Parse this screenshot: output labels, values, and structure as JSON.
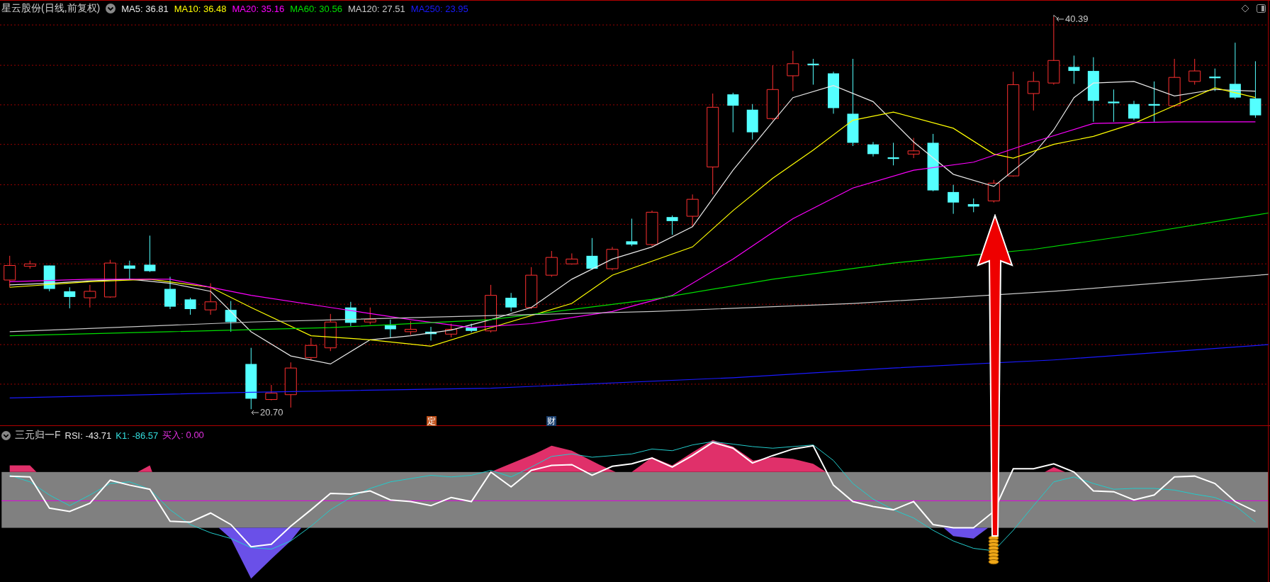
{
  "header": {
    "title": "星云股份(日线,前复权)",
    "indicators": [
      {
        "label": "MA5: 36.81",
        "color": "#e8e8e8"
      },
      {
        "label": "MA10: 36.48",
        "color": "#ffff00"
      },
      {
        "label": "MA20: 35.16",
        "color": "#ff00ff"
      },
      {
        "label": "MA60: 30.56",
        "color": "#00e000"
      },
      {
        "label": "MA120: 27.51",
        "color": "#c8c8c8"
      },
      {
        "label": "MA250: 23.95",
        "color": "#1a1aff"
      }
    ]
  },
  "price_labels": [
    {
      "kind": "high",
      "text": "40.39"
    },
    {
      "kind": "low",
      "text": "20.70"
    }
  ],
  "event_markers": [
    {
      "text": "定",
      "color": "#c0501a"
    },
    {
      "text": "财",
      "color": "#1a3f6e"
    }
  ],
  "indicator_panel": {
    "title": "三元归一F",
    "readings": [
      {
        "label": "RSI: -43.71",
        "color": "#e6e6e6"
      },
      {
        "label": "K1: -86.57",
        "color": "#33dddd"
      },
      {
        "label": "买入: 0.00",
        "color": "#e030e0"
      }
    ]
  }
}
